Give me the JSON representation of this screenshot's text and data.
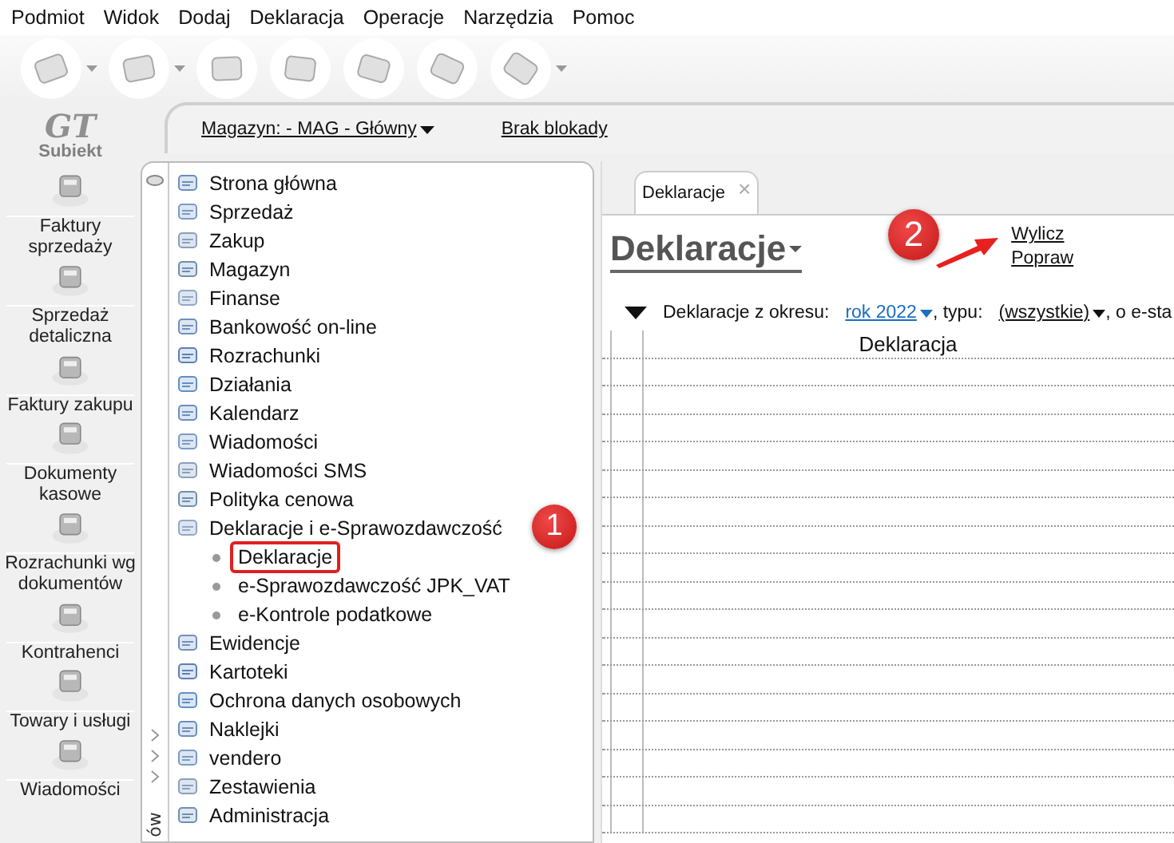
{
  "menu": [
    "Podmiot",
    "Widok",
    "Dodaj",
    "Deklaracja",
    "Operacje",
    "Narzędzia",
    "Pomoc"
  ],
  "logo": {
    "mark": "GT",
    "name": "Subiekt"
  },
  "sidebar": [
    {
      "label": "Faktury sprzedaży"
    },
    {
      "label": "Sprzedaż detaliczna"
    },
    {
      "label": "Faktury zakupu"
    },
    {
      "label": "Dokumenty kasowe"
    },
    {
      "label": "Rozrachunki wg dokumentów"
    },
    {
      "label": "Kontrahenci"
    },
    {
      "label": "Towary i usługi"
    },
    {
      "label": "Wiadomości"
    }
  ],
  "top_bar": {
    "warehouse": "Magazyn: - MAG - Główny",
    "lock_status": "Brak blokady"
  },
  "nav": {
    "side_tab": "ów",
    "items": [
      {
        "label": "Strona główna"
      },
      {
        "label": "Sprzedaż"
      },
      {
        "label": "Zakup"
      },
      {
        "label": "Magazyn"
      },
      {
        "label": "Finanse"
      },
      {
        "label": "Bankowość on-line"
      },
      {
        "label": "Rozrachunki"
      },
      {
        "label": "Działania"
      },
      {
        "label": "Kalendarz"
      },
      {
        "label": "Wiadomości"
      },
      {
        "label": "Wiadomości SMS"
      },
      {
        "label": "Polityka cenowa"
      },
      {
        "label": "Deklaracje i e-Sprawozdawczość",
        "children": [
          {
            "label": "Deklaracje",
            "selected": true
          },
          {
            "label": "e-Sprawozdawczość JPK_VAT",
            "selected": false
          },
          {
            "label": "e-Kontrole podatkowe",
            "selected": false
          }
        ]
      },
      {
        "label": "Ewidencje"
      },
      {
        "label": "Kartoteki"
      },
      {
        "label": "Ochrona danych osobowych"
      },
      {
        "label": "Naklejki"
      },
      {
        "label": "vendero"
      },
      {
        "label": "Zestawienia"
      },
      {
        "label": "Administracja"
      }
    ]
  },
  "tab": {
    "label": "Deklaracje",
    "close": "×"
  },
  "view_title": "Deklaracje",
  "actions": [
    "Wylicz",
    "Popraw"
  ],
  "filter": {
    "label": "Deklaracje z okresu:",
    "period": "rok 2022",
    "type_label": ", typu:",
    "type": "(wszystkie)",
    "status_label": ", o e-sta"
  },
  "table": {
    "columns": [
      "Deklaracja"
    ]
  },
  "callouts": [
    "1",
    "2"
  ]
}
